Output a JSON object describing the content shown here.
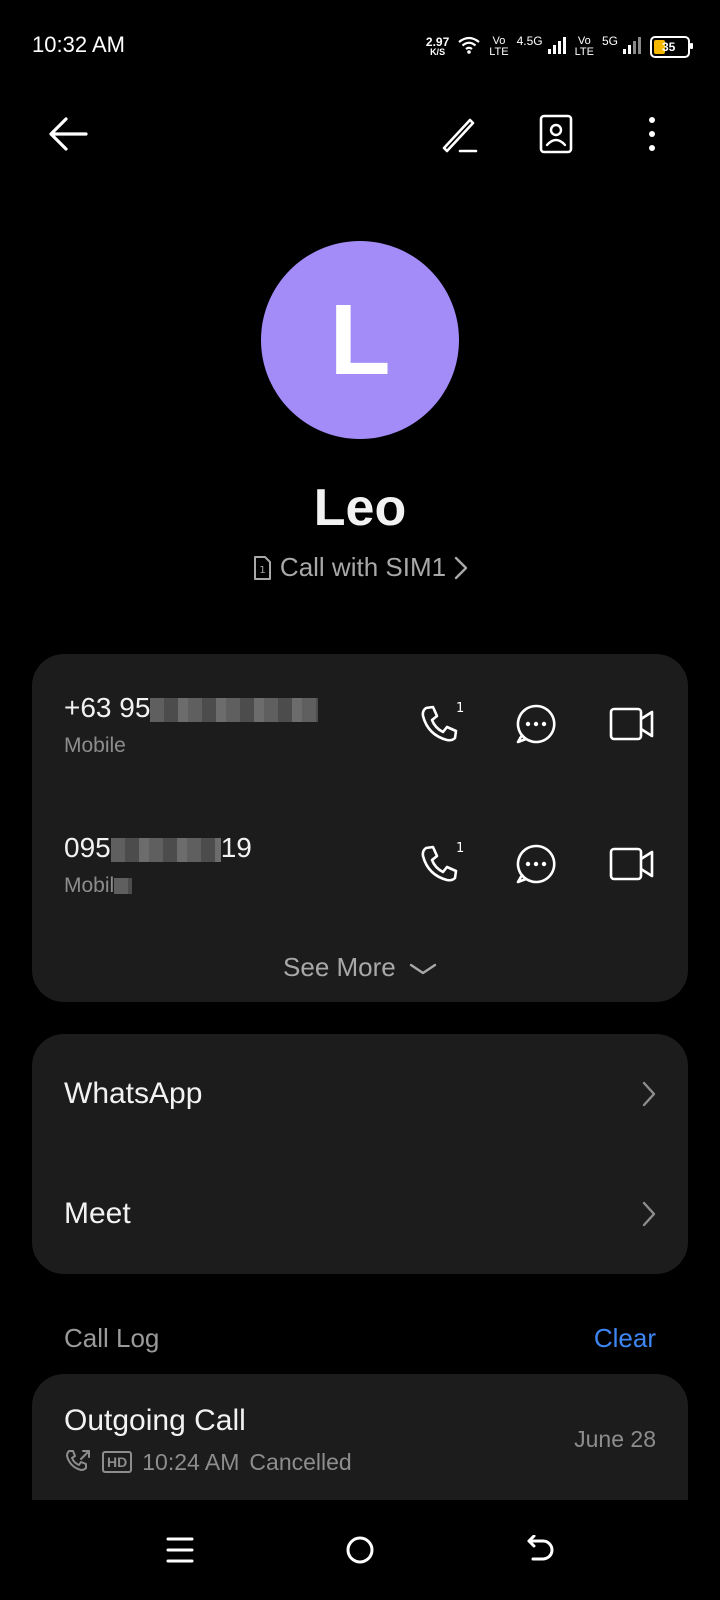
{
  "status_bar": {
    "time": "10:32 AM",
    "speed_value": "2.97",
    "speed_unit": "K/S",
    "sim1_network_top": "Vo",
    "sim1_network_bottom": "LTE",
    "sim1_tech": "4.5G",
    "sim2_network_top": "Vo",
    "sim2_network_bottom": "LTE",
    "sim2_tech": "5G",
    "battery_level": "35",
    "battery_color": "#f5b800"
  },
  "toolbar": {
    "back_icon": "back-arrow-icon",
    "edit_icon": "pencil-icon",
    "contact_card_icon": "contact-card-icon",
    "more_icon": "more-vertical-icon"
  },
  "contact": {
    "initial": "L",
    "avatar_color": "#a48cf8",
    "name": "Leo",
    "call_with": "Call with SIM1"
  },
  "numbers": [
    {
      "number_visible": "+63 95",
      "type": "Mobile",
      "sim_badge": "1"
    },
    {
      "number_visible_start": "095",
      "number_visible_end": "19",
      "type": "Mobil",
      "sim_badge": "1"
    }
  ],
  "see_more": "See More",
  "apps": [
    {
      "label": "WhatsApp"
    },
    {
      "label": "Meet"
    }
  ],
  "call_log": {
    "title": "Call Log",
    "clear_label": "Clear",
    "accent_color": "#3f86f5",
    "entries": [
      {
        "title": "Outgoing Call",
        "hd": "HD",
        "time": "10:24 AM",
        "status": "Cancelled",
        "date": "June 28"
      }
    ]
  }
}
